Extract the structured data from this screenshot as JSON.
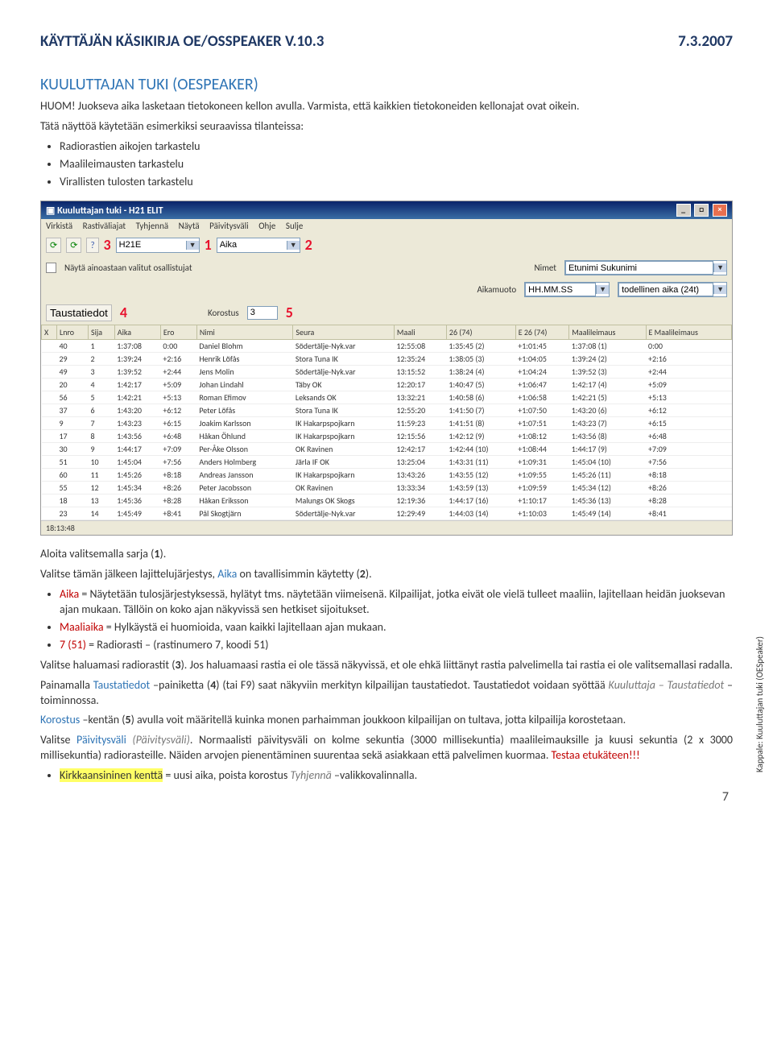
{
  "header": {
    "title_prefix": "KÄYTTÄJÄN KÄSIKIRJA",
    "title_product": "OE/OSSPEAKER V.10.3",
    "date": "7.3.2007"
  },
  "section": {
    "title_prefix": "KUULUTTAJAN TUKI",
    "title_paren": "(OESPEAKER)",
    "intro": "HUOM! Juokseva aika lasketaan tietokoneen kellon avulla. Varmista, että kaikkien tietokoneiden kellonajat ovat oikein.",
    "usage_lead": "Tätä näyttöä käytetään esimerkiksi seuraavissa tilanteissa:",
    "usage_items": [
      "Radiorastien aikojen tarkastelu",
      "Maalileimausten tarkastelu",
      "Virallisten tulosten tarkastelu"
    ]
  },
  "win": {
    "title": "Kuuluttajan tuki - H21 ELIT",
    "menu": [
      "Virkistä",
      "Rastiväliajat",
      "Tyhjennä",
      "Näytä",
      "Päivitysväli",
      "Ohje",
      "Sulje"
    ],
    "class_value": "H21E",
    "aika_label": "Aika",
    "nimet_label": "Nimet",
    "nimet_value": "Etunimi Sukunimi",
    "show_only": "Näytä ainoastaan valitut osallistujat",
    "aikamuoto_label": "Aikamuoto",
    "aikamuoto_value": "HH.MM.SS",
    "aikamuoto_opt": "todellinen aika (24t)",
    "taustatiedot": "Taustatiedot",
    "korostus_label": "Korostus",
    "korostus_value": "3",
    "marks": {
      "1": "1",
      "2": "2",
      "3": "3",
      "4": "4",
      "5": "5"
    },
    "cols": [
      "X",
      "Lnro",
      "Sija",
      "Aika",
      "Ero",
      "Nimi",
      "Seura",
      "Maali",
      "26 (74)",
      "E 26 (74)",
      "Maalileimaus",
      "E Maalileimaus"
    ],
    "rows": [
      [
        "",
        "40",
        "1",
        "1:37:08",
        "0:00",
        "Daniel Blohm",
        "Södertälje-Nyk.var",
        "12:55:08",
        "1:35:45 (2)",
        "+1:01:45",
        "1:37:08 (1)",
        "0:00"
      ],
      [
        "",
        "29",
        "2",
        "1:39:24",
        "+2:16",
        "Henrik Löfås",
        "Stora Tuna IK",
        "12:35:24",
        "1:38:05 (3)",
        "+1:04:05",
        "1:39:24 (2)",
        "+2:16"
      ],
      [
        "",
        "49",
        "3",
        "1:39:52",
        "+2:44",
        "Jens Molin",
        "Södertälje-Nyk.var",
        "13:15:52",
        "1:38:24 (4)",
        "+1:04:24",
        "1:39:52 (3)",
        "+2:44"
      ],
      [
        "",
        "20",
        "4",
        "1:42:17",
        "+5:09",
        "Johan Lindahl",
        "Täby OK",
        "12:20:17",
        "1:40:47 (5)",
        "+1:06:47",
        "1:42:17 (4)",
        "+5:09"
      ],
      [
        "",
        "56",
        "5",
        "1:42:21",
        "+5:13",
        "Roman Efimov",
        "Leksands OK",
        "13:32:21",
        "1:40:58 (6)",
        "+1:06:58",
        "1:42:21 (5)",
        "+5:13"
      ],
      [
        "",
        "37",
        "6",
        "1:43:20",
        "+6:12",
        "Peter Löfås",
        "Stora Tuna IK",
        "12:55:20",
        "1:41:50 (7)",
        "+1:07:50",
        "1:43:20 (6)",
        "+6:12"
      ],
      [
        "",
        "9",
        "7",
        "1:43:23",
        "+6:15",
        "Joakim Karlsson",
        "IK Hakarpspojkarn",
        "11:59:23",
        "1:41:51 (8)",
        "+1:07:51",
        "1:43:23 (7)",
        "+6:15"
      ],
      [
        "",
        "17",
        "8",
        "1:43:56",
        "+6:48",
        "Håkan Öhlund",
        "IK Hakarpspojkarn",
        "12:15:56",
        "1:42:12 (9)",
        "+1:08:12",
        "1:43:56 (8)",
        "+6:48"
      ],
      [
        "",
        "30",
        "9",
        "1:44:17",
        "+7:09",
        "Per-Åke Olsson",
        "OK Ravinen",
        "12:42:17",
        "1:42:44 (10)",
        "+1:08:44",
        "1:44:17 (9)",
        "+7:09"
      ],
      [
        "",
        "51",
        "10",
        "1:45:04",
        "+7:56",
        "Anders Holmberg",
        "Järla IF OK",
        "13:25:04",
        "1:43:31 (11)",
        "+1:09:31",
        "1:45:04 (10)",
        "+7:56"
      ],
      [
        "",
        "60",
        "11",
        "1:45:26",
        "+8:18",
        "Andreas Jansson",
        "IK Hakarpspojkarn",
        "13:43:26",
        "1:43:55 (12)",
        "+1:09:55",
        "1:45:26 (11)",
        "+8:18"
      ],
      [
        "",
        "55",
        "12",
        "1:45:34",
        "+8:26",
        "Peter Jacobsson",
        "OK Ravinen",
        "13:33:34",
        "1:43:59 (13)",
        "+1:09:59",
        "1:45:34 (12)",
        "+8:26"
      ],
      [
        "",
        "18",
        "13",
        "1:45:36",
        "+8:28",
        "Håkan Eriksson",
        "Malungs OK Skogs",
        "12:19:36",
        "1:44:17 (16)",
        "+1:10:17",
        "1:45:36 (13)",
        "+8:28"
      ],
      [
        "",
        "23",
        "14",
        "1:45:49",
        "+8:41",
        "Pål Skogtjärn",
        "Södertälje-Nyk.var",
        "12:29:49",
        "1:44:03 (14)",
        "+1:10:03",
        "1:45:49 (14)",
        "+8:41"
      ]
    ],
    "status": "18:13:48"
  },
  "body": {
    "p1": "Aloita valitsemalla sarja (",
    "p1b": ").",
    "p2a": "Valitse tämän jälkeen lajittelujärjestys, ",
    "p2_aika": "Aika",
    "p2b": " on tavallisimmin käytetty (",
    "p2c": ").",
    "b1a": "Aika",
    "b1b": " = Näytetään tulosjärjestyksessä, hylätyt tms. näytetään viimeisenä. Kilpailijat, jotka eivät ole vielä tulleet maaliin, lajitellaan heidän juoksevan ajan mukaan. Tällöin on koko ajan näkyvissä sen hetkiset sijoitukset.",
    "b2a": "Maaliaika",
    "b2b": " = Hylkäystä ei huomioida, vaan kaikki lajitellaan ajan mukaan.",
    "b3a": "7 (51)",
    "b3b": " = Radiorasti – (rastinumero 7, koodi 51)",
    "p3a": "Valitse haluamasi radiorastit (",
    "p3b": "). Jos haluamaasi rastia ei ole tässä näkyvissä, et ole ehkä liittänyt rastia palvelimella tai rastia ei ole valitsemallasi radalla.",
    "p4a": "Painamalla ",
    "p4_t": "Taustatiedot",
    "p4b": " –painiketta (",
    "p4c": ") (tai F9) saat näkyviin merkityn kilpailijan taustatiedot. Taustatiedot voidaan syöttää ",
    "p4_kt": "Kuuluttaja – Taustatiedot",
    "p4d": " –toiminnossa.",
    "p5a": "Korostus",
    "p5b": " –kentän (",
    "p5c": ") avulla voit määritellä kuinka monen parhaimman joukkoon kilpailijan on tultava, jotta kilpailija korostetaan.",
    "p6a": "Valitse ",
    "p6_pv": "Päivitysväli",
    "p6_par": " (Päivitysväli)",
    "p6b": ". Normaalisti päivitysväli on kolme sekuntia (3000 millisekuntia) maalileimauksille ja kuusi sekuntia (2 x 3000 millisekuntia) radiorasteille. Näiden arvojen pienentäminen suurentaa sekä asiakkaan että palvelimen kuormaa. ",
    "p6_test": "Testaa etukäteen!!!",
    "b4a": "Kirkkaansininen kenttä",
    "b4b": " = uusi aika, poista korostus ",
    "b4_t": "Tyhjennä",
    "b4c": " –valikkovalinnalla."
  },
  "side": {
    "kappale": "Kappale: ",
    "text": "Kuuluttajan tuki (OESpeaker)"
  },
  "pagenum": "7",
  "nums": {
    "n1": "1",
    "n2": "2",
    "n3": "3",
    "n4": "4",
    "n5": "5"
  }
}
